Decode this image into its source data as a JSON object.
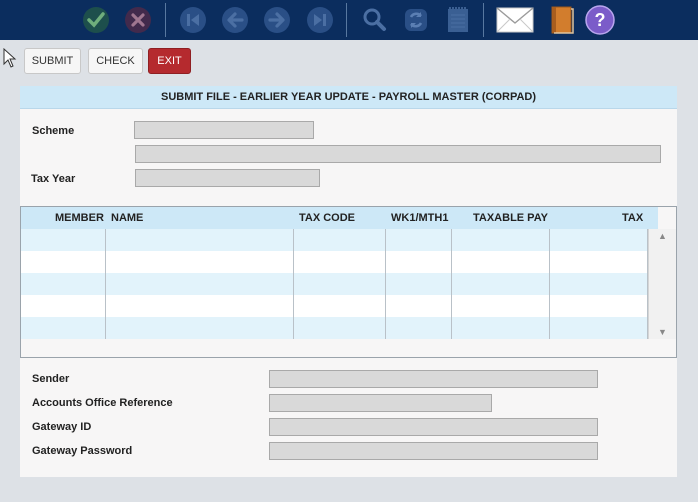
{
  "toolbar": {
    "icons": [
      {
        "name": "confirm-check-icon",
        "color": "#2e8b3e"
      },
      {
        "name": "cancel-x-icon",
        "color": "#a02a35"
      },
      {
        "name": "first-record-icon",
        "color": "#2a5fa8"
      },
      {
        "name": "previous-record-icon",
        "color": "#2a5fa8"
      },
      {
        "name": "next-record-icon",
        "color": "#2a5fa8"
      },
      {
        "name": "last-record-icon",
        "color": "#2a5fa8"
      },
      {
        "name": "search-magnifier-icon",
        "color": "#2a5fa8"
      },
      {
        "name": "refresh-icon",
        "color": "#2a5fa8"
      },
      {
        "name": "notepad-icon",
        "color": "#2a5fa8"
      },
      {
        "name": "mail-envelope-icon",
        "color": "#ffffff"
      },
      {
        "name": "book-icon",
        "color": "#d27d2d"
      },
      {
        "name": "help-icon",
        "color": "#7b5cc9"
      }
    ]
  },
  "actions": {
    "submit_label": "SUBMIT",
    "check_label": "CHECK",
    "exit_label": "EXIT"
  },
  "panel": {
    "title": "SUBMIT FILE - EARLIER YEAR UPDATE - PAYROLL MASTER (CORPAD)"
  },
  "form": {
    "scheme_label": "Scheme",
    "scheme_value": "",
    "scheme_name_value": "",
    "tax_year_label": "Tax Year",
    "tax_year_value": ""
  },
  "grid": {
    "columns": [
      "MEMBER",
      "NAME",
      "TAX CODE",
      "WK1/MTH1",
      "TAXABLE PAY",
      "TAX"
    ],
    "rows": [
      [
        "",
        "",
        "",
        "",
        "",
        ""
      ],
      [
        "",
        "",
        "",
        "",
        "",
        ""
      ],
      [
        "",
        "",
        "",
        "",
        "",
        ""
      ],
      [
        "",
        "",
        "",
        "",
        "",
        ""
      ],
      [
        "",
        "",
        "",
        "",
        "",
        ""
      ]
    ]
  },
  "gateway": {
    "sender_label": "Sender",
    "sender_value": "",
    "accounts_office_ref_label": "Accounts Office Reference",
    "accounts_office_ref_value": "",
    "gateway_id_label": "Gateway ID",
    "gateway_id_value": "",
    "gateway_password_label": "Gateway Password",
    "gateway_password_value": ""
  }
}
